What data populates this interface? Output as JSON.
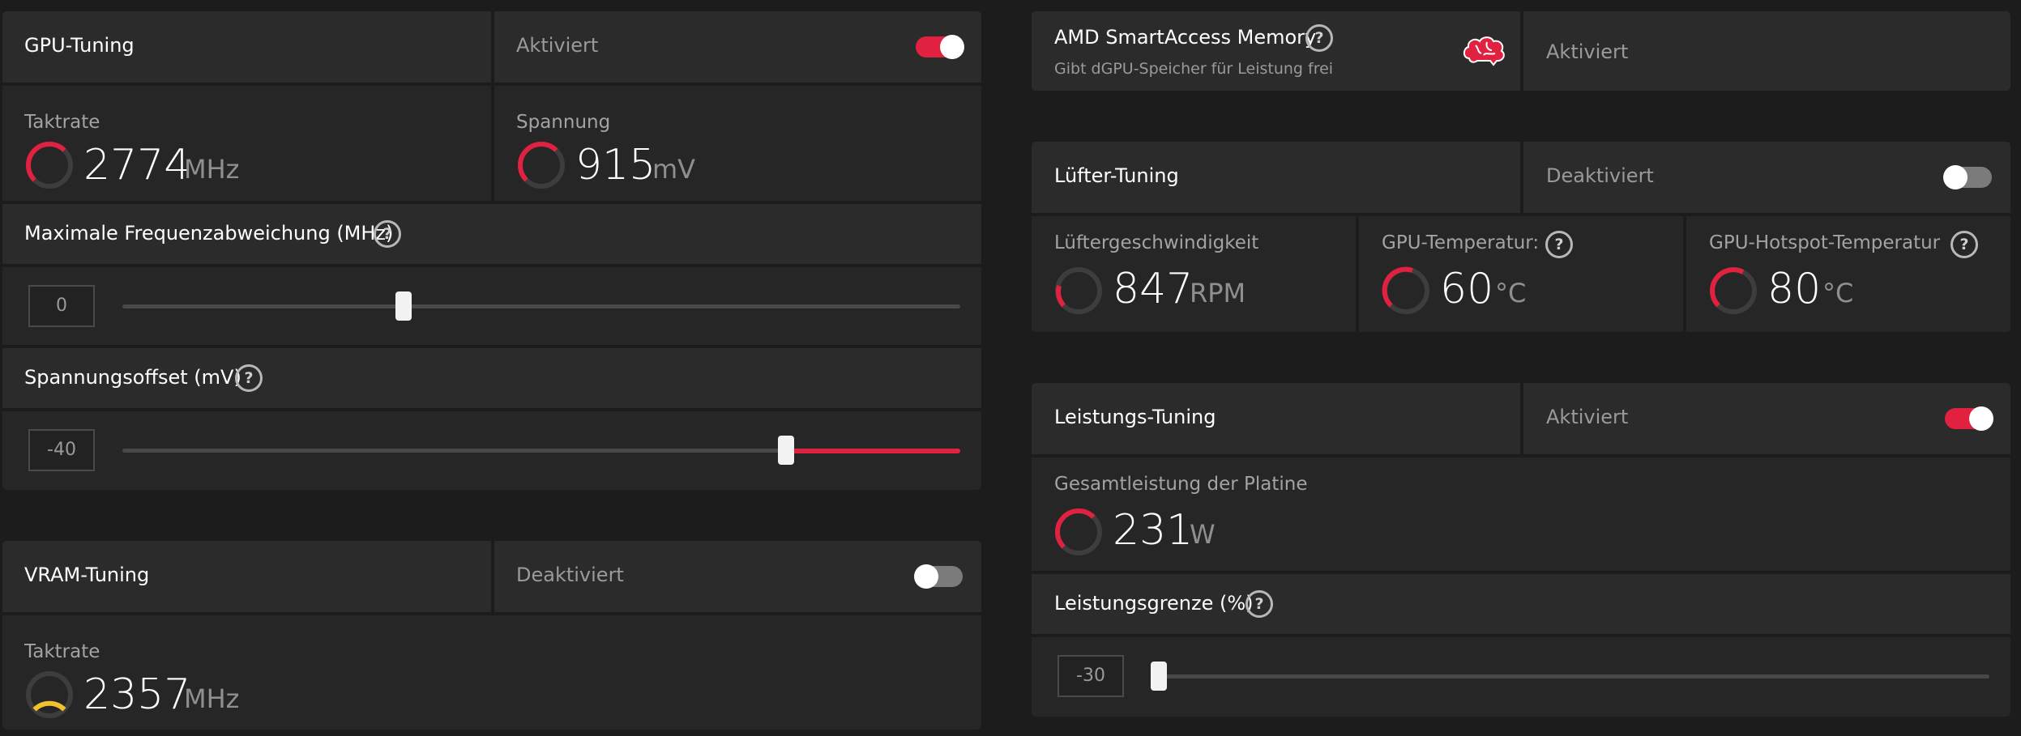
{
  "gpu_tuning": {
    "title": "GPU-Tuning",
    "status": "Aktiviert",
    "toggle_on": true,
    "clock": {
      "label": "Taktrate",
      "value": "2774",
      "unit": "MHz"
    },
    "voltage": {
      "label": "Spannung",
      "value": "915",
      "unit": "mV"
    },
    "max_freq_offset": {
      "label": "Maximale Frequenzabweichung (MHz)",
      "value": "0",
      "slider_fraction": 0.335
    },
    "voltage_offset": {
      "label": "Spannungsoffset (mV)",
      "value": "-40",
      "slider_fraction": 0.79
    }
  },
  "vram_tuning": {
    "title": "VRAM-Tuning",
    "status": "Deaktiviert",
    "toggle_on": false,
    "clock": {
      "label": "Taktrate",
      "value": "2357",
      "unit": "MHz"
    }
  },
  "smart_access": {
    "title": "AMD SmartAccess Memory",
    "subtitle": "Gibt dGPU-Speicher für Leistung frei",
    "status": "Aktiviert"
  },
  "fan_tuning": {
    "title": "Lüfter-Tuning",
    "status": "Deaktiviert",
    "toggle_on": false,
    "fan_speed": {
      "label": "Lüftergeschwindigkeit",
      "value": "847",
      "unit": "RPM"
    },
    "gpu_temp": {
      "label": "GPU-Temperatur:",
      "value": "60",
      "unit": "°C"
    },
    "hotspot_temp": {
      "label": "GPU-Hotspot-Temperatur",
      "value": "80",
      "unit": "°C"
    }
  },
  "power_tuning": {
    "title": "Leistungs-Tuning",
    "status": "Aktiviert",
    "toggle_on": true,
    "board_power": {
      "label": "Gesamtleistung der Platine",
      "value": "231",
      "unit": "W"
    },
    "power_limit": {
      "label": "Leistungsgrenze (%)",
      "value": "-30",
      "slider_fraction": 0.0
    }
  },
  "icons": {
    "help": "help-circle-icon",
    "gauge": "gauge-arc-icon",
    "brain": "brain-icon"
  },
  "colors": {
    "accent": "#e0213f",
    "gauge_vram": "#f2c12e",
    "background": "#1c1c1c",
    "panel": "#262626"
  }
}
